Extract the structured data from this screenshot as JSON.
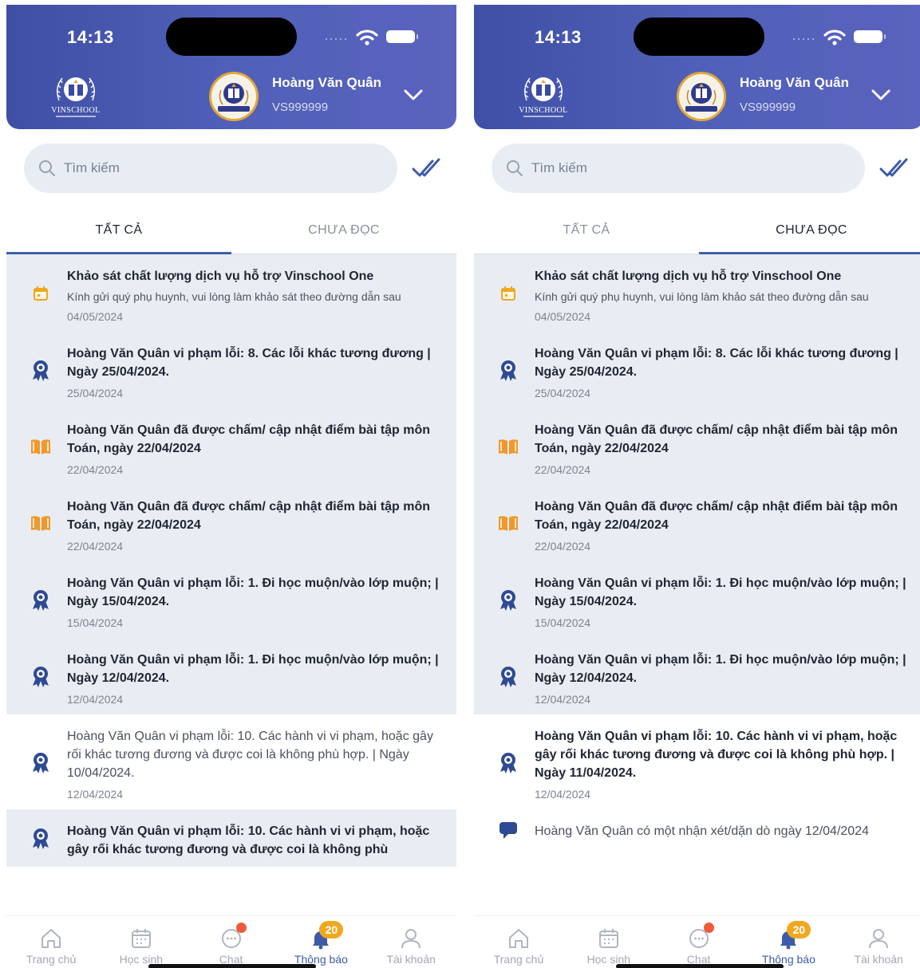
{
  "status_bar": {
    "time": "14:13"
  },
  "header": {
    "school_name": "VINSCHOOL",
    "student_name": "Hoàng Văn Quân",
    "student_id": "VS999999"
  },
  "search": {
    "placeholder": "Tìm kiếm"
  },
  "tabs": {
    "all": "TẤT CẢ",
    "unread": "CHƯA ĐỌC"
  },
  "colors": {
    "header": "#4a5ab3",
    "accent": "#3d5ba8",
    "unread_bg": "#e9edf3",
    "badge": "#f0a820",
    "dot": "#ee5a3a"
  },
  "screens": [
    {
      "active_tab": "all",
      "items": [
        {
          "icon": "calendar-icon",
          "unread": true,
          "title": "Khảo sát chất lượng dịch vụ hỗ trợ Vinschool One",
          "desc": "Kính gửi quý phụ huynh, vui lòng làm khảo sát theo đường dẫn sau",
          "date": "04/05/2024"
        },
        {
          "icon": "award-icon",
          "unread": true,
          "title": "Hoàng Văn Quân vi phạm lỗi: 8. Các lỗi khác tương đương | Ngày 25/04/2024.",
          "date": "25/04/2024"
        },
        {
          "icon": "book-icon",
          "unread": true,
          "title": "Hoàng Văn Quân đã được chấm/ cập nhật điểm bài tập môn Toán, ngày 22/04/2024",
          "date": "22/04/2024"
        },
        {
          "icon": "book-icon",
          "unread": true,
          "title": "Hoàng Văn Quân đã được chấm/ cập nhật điểm bài tập môn Toán, ngày 22/04/2024",
          "date": "22/04/2024"
        },
        {
          "icon": "award-icon",
          "unread": true,
          "title": "Hoàng Văn Quân vi phạm lỗi: 1. Đi học muộn/vào lớp muộn; | Ngày 15/04/2024.",
          "date": "15/04/2024"
        },
        {
          "icon": "award-icon",
          "unread": true,
          "title": "Hoàng Văn Quân vi phạm lỗi: 1. Đi học muộn/vào lớp muộn; | Ngày 12/04/2024.",
          "date": "12/04/2024"
        },
        {
          "icon": "award-icon",
          "unread": false,
          "title": "Hoàng Văn Quân vi phạm lỗi: 10. Các hành vi vi phạm, hoặc gây rối khác tương đương và được coi là không phù hợp. | Ngày 10/04/2024.",
          "date": "12/04/2024"
        },
        {
          "icon": "award-icon",
          "unread": true,
          "title": "Hoàng Văn Quân vi phạm lỗi: 10. Các hành vi vi phạm, hoặc gây rối khác tương đương và được coi là không phù",
          "date": ""
        }
      ]
    },
    {
      "active_tab": "unread",
      "items": [
        {
          "icon": "calendar-icon",
          "unread": true,
          "title": "Khảo sát chất lượng dịch vụ hỗ trợ Vinschool One",
          "desc": "Kính gửi quý phụ huynh, vui lòng làm khảo sát theo đường dẫn sau",
          "date": "04/05/2024"
        },
        {
          "icon": "award-icon",
          "unread": true,
          "title": "Hoàng Văn Quân vi phạm lỗi: 8. Các lỗi khác tương đương | Ngày 25/04/2024.",
          "date": "25/04/2024"
        },
        {
          "icon": "book-icon",
          "unread": true,
          "title": "Hoàng Văn Quân đã được chấm/ cập nhật điểm bài tập môn Toán, ngày 22/04/2024",
          "date": "22/04/2024"
        },
        {
          "icon": "book-icon",
          "unread": true,
          "title": "Hoàng Văn Quân đã được chấm/ cập nhật điểm bài tập môn Toán, ngày 22/04/2024",
          "date": "22/04/2024"
        },
        {
          "icon": "award-icon",
          "unread": true,
          "title": "Hoàng Văn Quân vi phạm lỗi: 1. Đi học muộn/vào lớp muộn; | Ngày 15/04/2024.",
          "date": "15/04/2024"
        },
        {
          "icon": "award-icon",
          "unread": true,
          "title": "Hoàng Văn Quân vi phạm lỗi: 1. Đi học muộn/vào lớp muộn; | Ngày 12/04/2024.",
          "date": "12/04/2024"
        },
        {
          "icon": "award-icon",
          "unread": false,
          "bold": true,
          "title": "Hoàng Văn Quân vi phạm lỗi: 10. Các hành vi vi phạm, hoặc gây rối khác tương đương và được coi là không phù hợp. | Ngày 11/04/2024.",
          "date": "12/04/2024"
        },
        {
          "icon": "comment-icon",
          "unread": false,
          "title": "Hoàng Văn Quân có một nhận xét/dặn dò ngày 12/04/2024",
          "date": ""
        }
      ]
    }
  ],
  "bottom_nav": [
    {
      "label": "Trang chủ",
      "icon": "home-icon"
    },
    {
      "label": "Học sinh",
      "icon": "calendar-grid-icon"
    },
    {
      "label": "Chat",
      "icon": "chat-icon",
      "dot": true
    },
    {
      "label": "Thông báo",
      "icon": "bell-icon",
      "badge": "20",
      "active": true
    },
    {
      "label": "Tài khoản",
      "icon": "user-icon"
    }
  ]
}
